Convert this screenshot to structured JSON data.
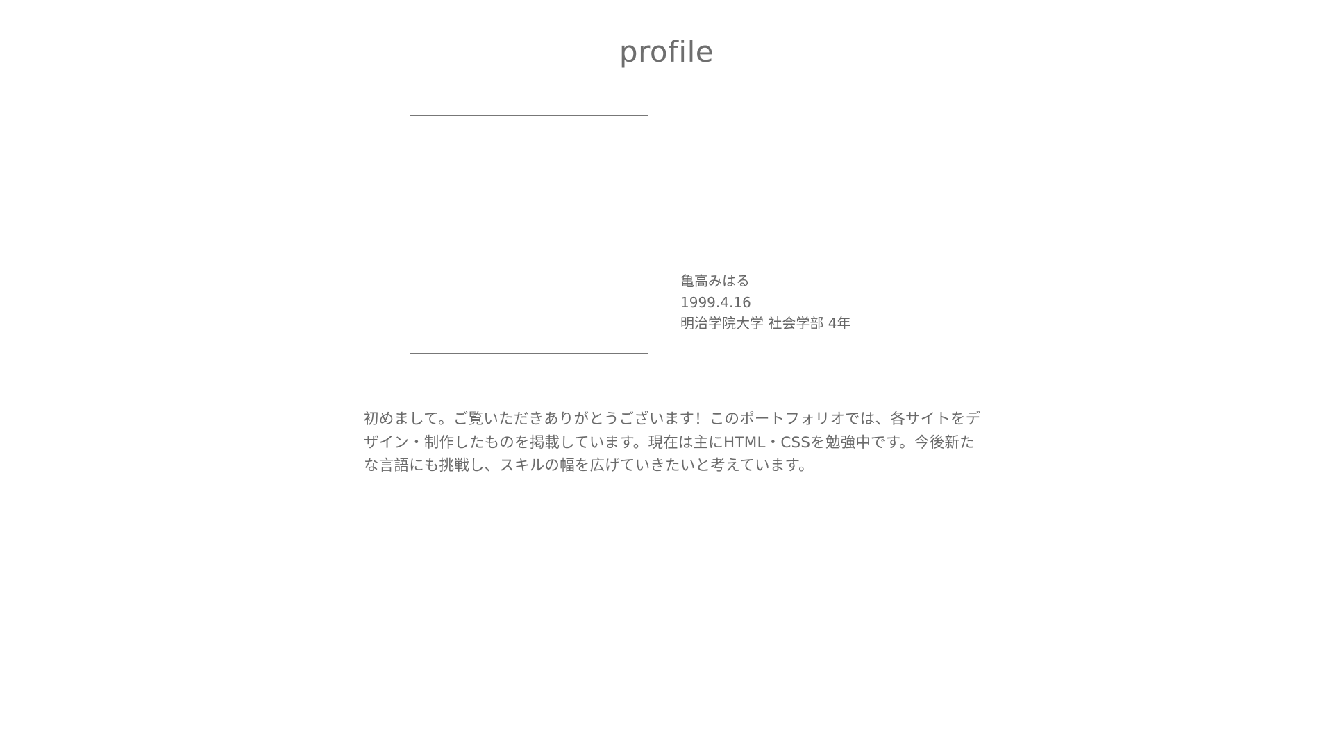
{
  "section": {
    "title": "profile"
  },
  "profile": {
    "name": "亀高みはる",
    "birthdate": "1999.4.16",
    "school": "明治学院大学 社会学部 4年"
  },
  "intro": {
    "text": "初めまして。ご覧いただきありがとうございます！このポートフォリオでは、各サイトをデザイン・制作したものを掲載しています。現在は主にHTML・CSSを勉強中です。今後新たな言語にも挑戦し、スキルの幅を広げていきたいと考えています。"
  }
}
